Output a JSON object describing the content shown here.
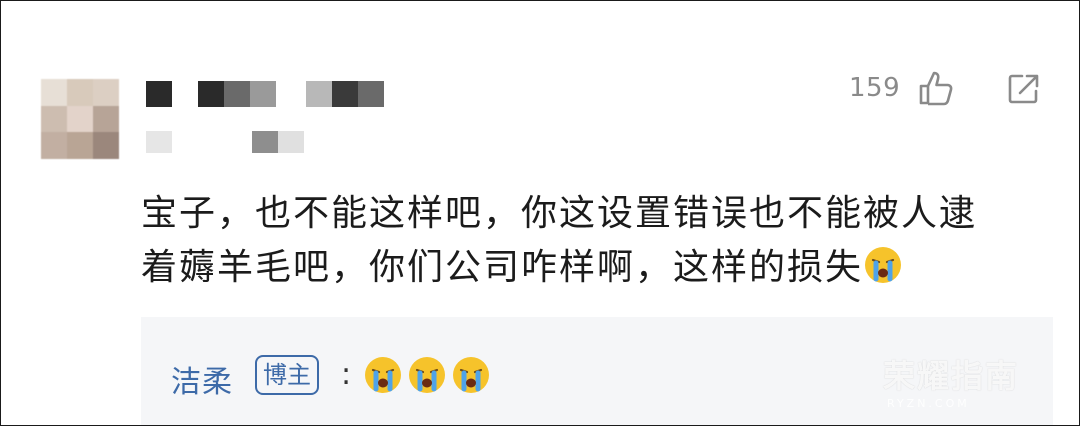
{
  "comment": {
    "like_count": "159",
    "text_line1": "宝子，也不能这样吧，你这设置错误也不能被人逮",
    "text_line2": "着薅羊毛吧，你们公司咋样啊，这样的损失",
    "emoji_name": "crying-face-icon"
  },
  "reply": {
    "author": "洁柔",
    "badge": "博主",
    "separator": ":",
    "emoji_count": 3
  },
  "watermark": {
    "text": "荣耀指南",
    "sub": "RYZN.COM"
  },
  "colors": {
    "reply_link": "#3d6aa8",
    "reply_bg": "#f5f6f8",
    "emoji_yellow": "#f6c32b",
    "emoji_tear": "#4fa3e8",
    "meta_gray": "#8a8a8a"
  }
}
